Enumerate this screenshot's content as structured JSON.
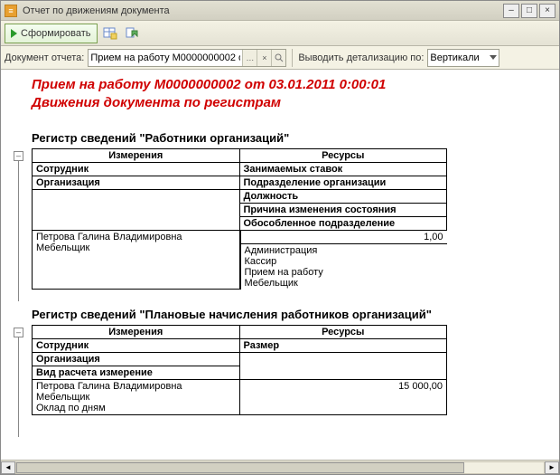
{
  "window": {
    "title": "Отчет по движениям документа"
  },
  "toolbar": {
    "form_btn": "Сформировать"
  },
  "params": {
    "doc_label": "Документ отчета:",
    "doc_value": "Прием на работу М0000000002 от 03.01.2011 0:00:01",
    "detail_label": "Выводить детализацию по:",
    "detail_value": "Вертикали"
  },
  "report": {
    "title1": "Прием на работу М0000000002 от 03.01.2011 0:00:01",
    "title2": "Движения документа по регистрам",
    "sections": [
      {
        "heading": "Регистр сведений \"Работники организаций\"",
        "col_left_hdr": "Измерения",
        "col_right_hdr": "Ресурсы",
        "dim_rows": [
          {
            "left": "Сотрудник",
            "right": "Занимаемых ставок"
          },
          {
            "left": "Организация",
            "right": "Подразделение организации"
          },
          {
            "left": "",
            "right": "Должность"
          },
          {
            "left": "",
            "right": "Причина изменения состояния"
          },
          {
            "left": "",
            "right": "Обособленное подразделение"
          }
        ],
        "data_left": "Петрова Галина Владимировна\nМебельщик",
        "data_right_num": "1,00",
        "data_right_lines": "Администрация\nКассир\nПрием на работу\nМебельщик"
      },
      {
        "heading": "Регистр сведений \"Плановые начисления работников организаций\"",
        "col_left_hdr": "Измерения",
        "col_right_hdr": "Ресурсы",
        "dim_rows": [
          {
            "left": "Сотрудник",
            "right": "Размер"
          },
          {
            "left": "Организация",
            "right": ""
          },
          {
            "left": "Вид расчета измерение",
            "right": ""
          }
        ],
        "data_left": "Петрова Галина Владимировна\nМебельщик\nОклад по дням",
        "data_right_num": "15 000,00",
        "data_right_lines": ""
      }
    ]
  },
  "icons": {
    "table": "table-icon",
    "refresh": "refresh-icon"
  }
}
